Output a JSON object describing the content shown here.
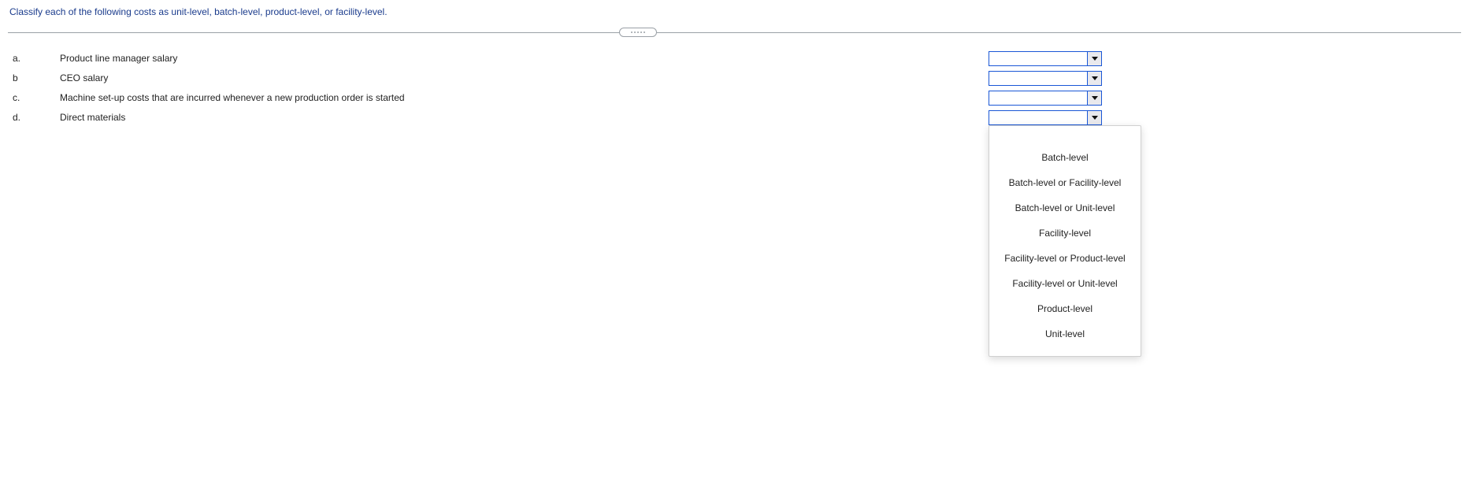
{
  "instruction": "Classify each of the following costs as unit-level, batch-level, product-level, or facility-level.",
  "rows": [
    {
      "letter": "a.",
      "text": "Product line manager salary",
      "value": ""
    },
    {
      "letter": "b",
      "text": "CEO salary",
      "value": ""
    },
    {
      "letter": "c.",
      "text": "Machine set-up costs that are incurred whenever a new production order is started",
      "value": ""
    },
    {
      "letter": "d.",
      "text": "Direct materials",
      "value": ""
    }
  ],
  "dropdown_open_index": 3,
  "dropdown_options": [
    "Batch-level",
    "Batch-level or Facility-level",
    "Batch-level or Unit-level",
    "Facility-level",
    "Facility-level or Product-level",
    "Facility-level or Unit-level",
    "Product-level",
    "Unit-level"
  ]
}
